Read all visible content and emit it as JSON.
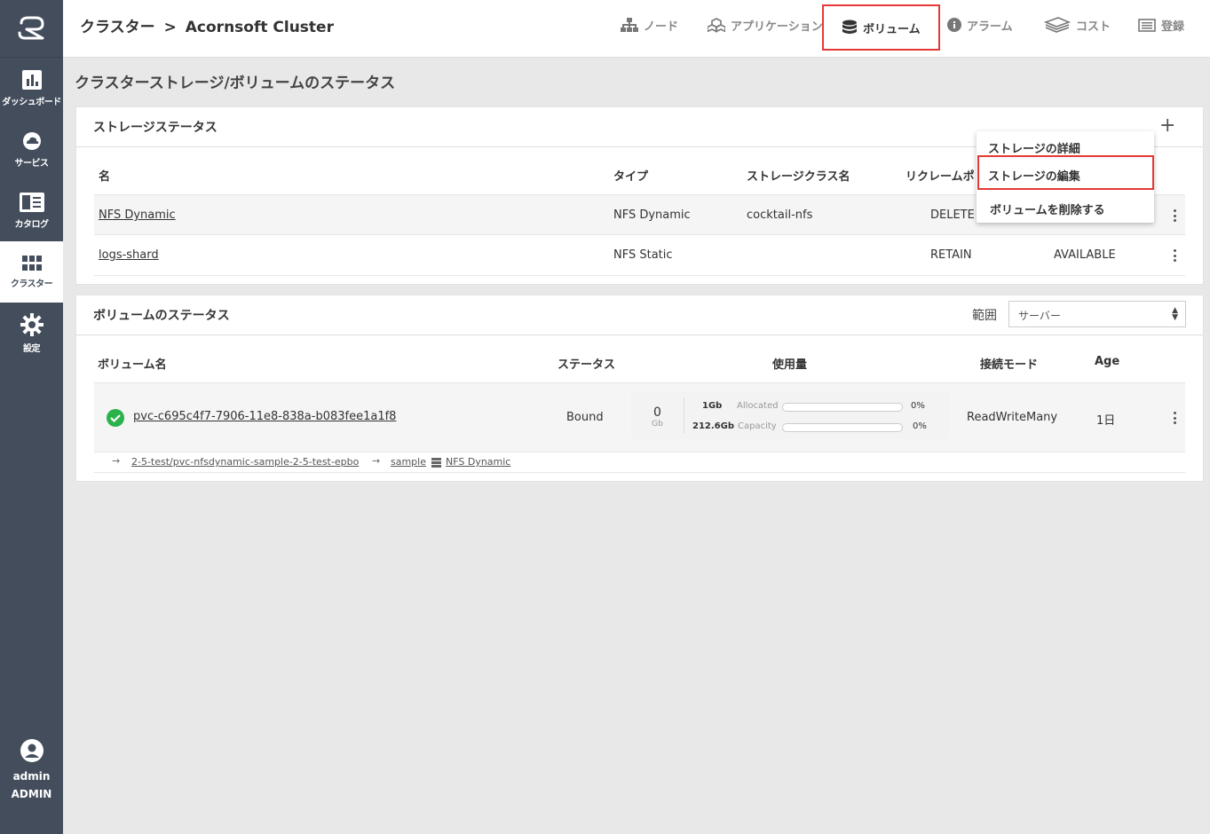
{
  "sidebar": {
    "items": [
      {
        "label": "ダッシュボード",
        "icon": "chart-icon"
      },
      {
        "label": "サービス",
        "icon": "cloud-icon"
      },
      {
        "label": "カタログ",
        "icon": "catalog-icon"
      },
      {
        "label": "クラスター",
        "icon": "grid-icon"
      },
      {
        "label": "設定",
        "icon": "gear-icon"
      }
    ],
    "user": {
      "name": "admin",
      "role": "ADMIN"
    }
  },
  "header": {
    "breadcrumb_root": "クラスター",
    "breadcrumb_sep": ">",
    "breadcrumb_current": "Acornsoft Cluster",
    "tabs": [
      {
        "label": "ノード",
        "icon": "node-tree-icon"
      },
      {
        "label": "アプリケーション",
        "icon": "cubes-icon"
      },
      {
        "label": "ボリューム",
        "icon": "database-icon"
      },
      {
        "label": "アラーム",
        "icon": "info-icon"
      },
      {
        "label": "コスト",
        "icon": "money-icon"
      },
      {
        "label": "登録",
        "icon": "list-icon"
      }
    ],
    "active_tab": "ボリューム"
  },
  "page_title": "クラスターストレージ/ボリュームのステータス",
  "storage": {
    "title": "ストレージステータス",
    "add_label": "+",
    "columns": [
      "名",
      "タイプ",
      "ストレージクラス名",
      "リクレームポリ"
    ],
    "rows": [
      {
        "name": "NFS Dynamic",
        "type": "NFS Dynamic",
        "class": "cocktail-nfs",
        "reclaim": "DELETE",
        "status": ""
      },
      {
        "name": "logs-shard",
        "type": "NFS Static",
        "class": "",
        "reclaim": "RETAIN",
        "status": "AVAILABLE"
      }
    ],
    "menu": {
      "items": [
        "ストレージの詳細",
        "ストレージの編集",
        "ボリュームを削除する"
      ],
      "highlighted": "ストレージの編集"
    }
  },
  "volumes": {
    "title": "ボリュームのステータス",
    "scope_label": "範囲",
    "scope_value": "サーバー",
    "columns": [
      "ボリューム名",
      "ステータス",
      "使用量",
      "接続モード",
      "Age"
    ],
    "rows": [
      {
        "name": "pvc-c695c4f7-7906-11e8-838a-b083fee1a1f8",
        "status": "Bound",
        "usage_value": "0",
        "usage_unit": "Gb",
        "allocated_amount": "1Gb",
        "allocated_label": "Allocated",
        "allocated_pct": "0%",
        "allocated_fraction": 0,
        "capacity_amount": "212.6Gb",
        "capacity_label": "Capacity",
        "capacity_pct": "0%",
        "capacity_fraction": 0,
        "mode": "ReadWriteMany",
        "age": "1日",
        "path_claim": "2-5-test/pvc-nfsdynamic-sample-2-5-test-epbo",
        "path_app": "sample",
        "path_storage": "NFS Dynamic"
      }
    ]
  }
}
